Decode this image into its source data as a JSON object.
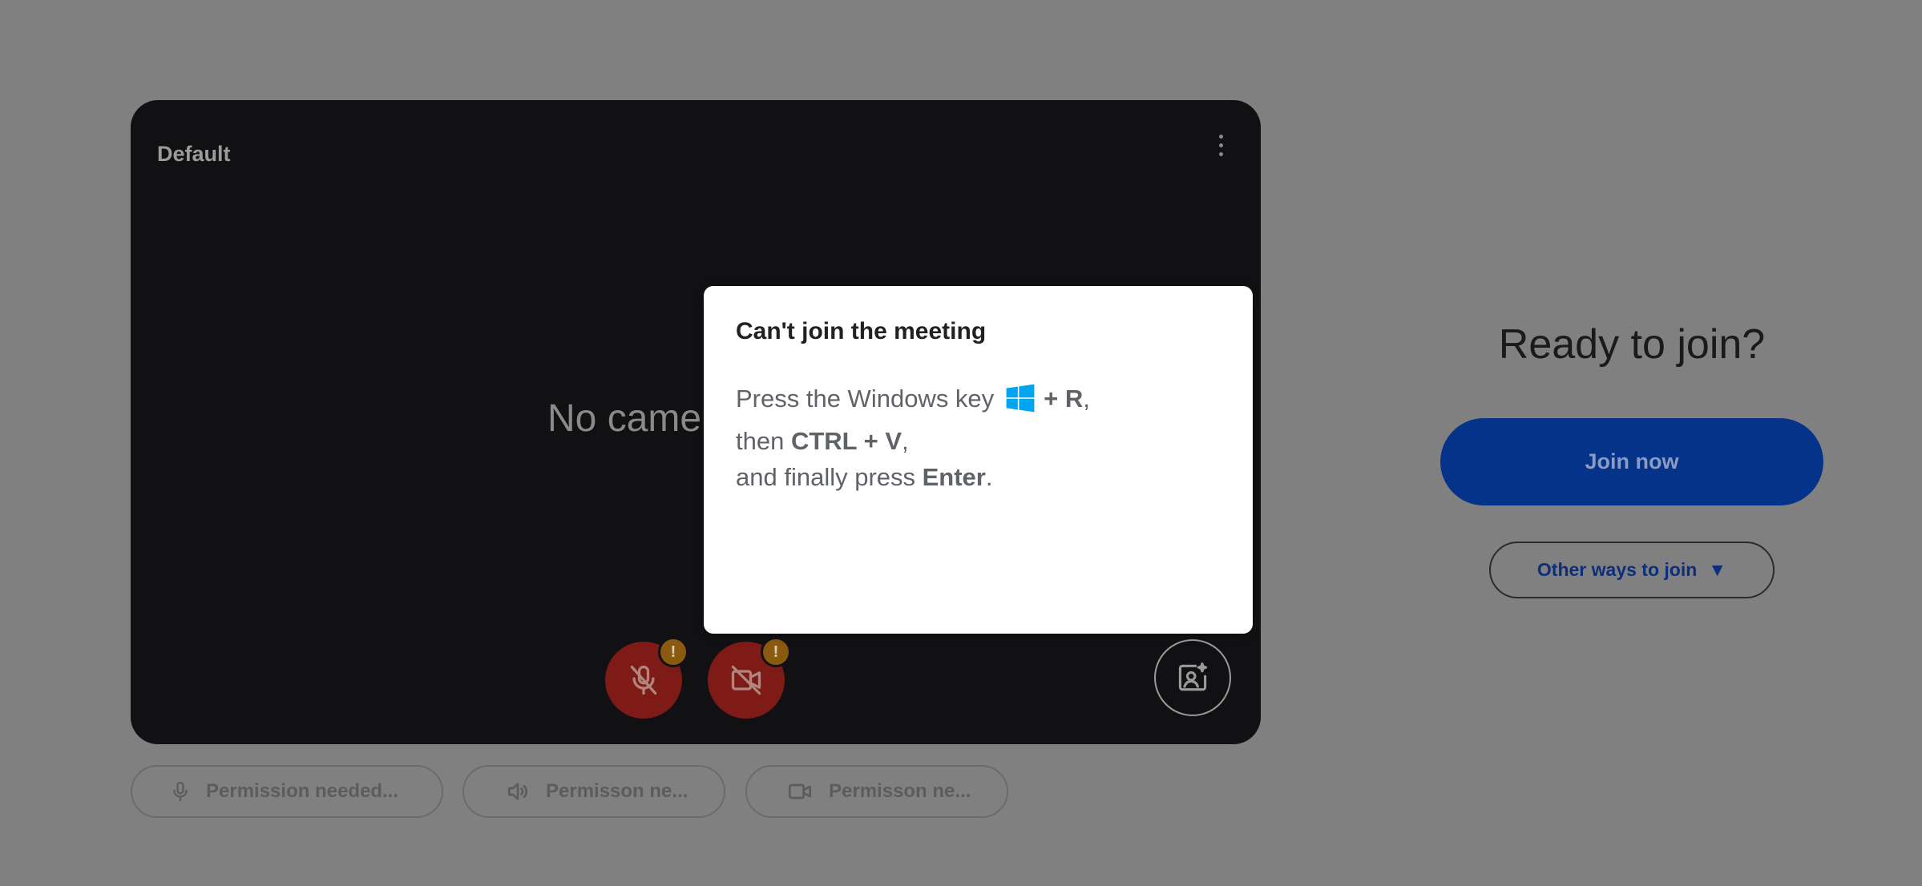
{
  "preview": {
    "device_name": "Default",
    "status_text": "No came",
    "more_icon": "more-vert-icon",
    "mic_button": {
      "icon": "mic-off-icon",
      "badge": "!"
    },
    "camera_button": {
      "icon": "videocam-off-icon",
      "badge": "!"
    },
    "effects_icon": "visual-effects-icon",
    "colors": {
      "background": "#111114",
      "control_red": "#7e1b16",
      "badge": "#8a5a10"
    }
  },
  "permissions": {
    "microphone": {
      "icon": "mic-icon",
      "label": "Permission needed..."
    },
    "speaker": {
      "icon": "speaker-icon",
      "label": "Permisson ne..."
    },
    "camera": {
      "icon": "videocam-icon",
      "label": "Permisson ne..."
    }
  },
  "join_panel": {
    "title": "Ready to join?",
    "join_label": "Join now",
    "other_ways_label": "Other ways to join",
    "other_ways_caret": "▼",
    "colors": {
      "join_button": "#06338a"
    }
  },
  "dialog": {
    "title": "Can't join the meeting",
    "line1_prefix": "Press the Windows key",
    "line1_keys": "+ R",
    "line1_suffix": ",",
    "line2_prefix": "then ",
    "line2_keys": "CTRL + V",
    "line2_suffix": ",",
    "line3_prefix": "and finally press ",
    "line3_keys": "Enter",
    "line3_suffix": ".",
    "windows_icon": "windows-logo-icon",
    "colors": {
      "windows_logo": "#00a4ef"
    }
  }
}
